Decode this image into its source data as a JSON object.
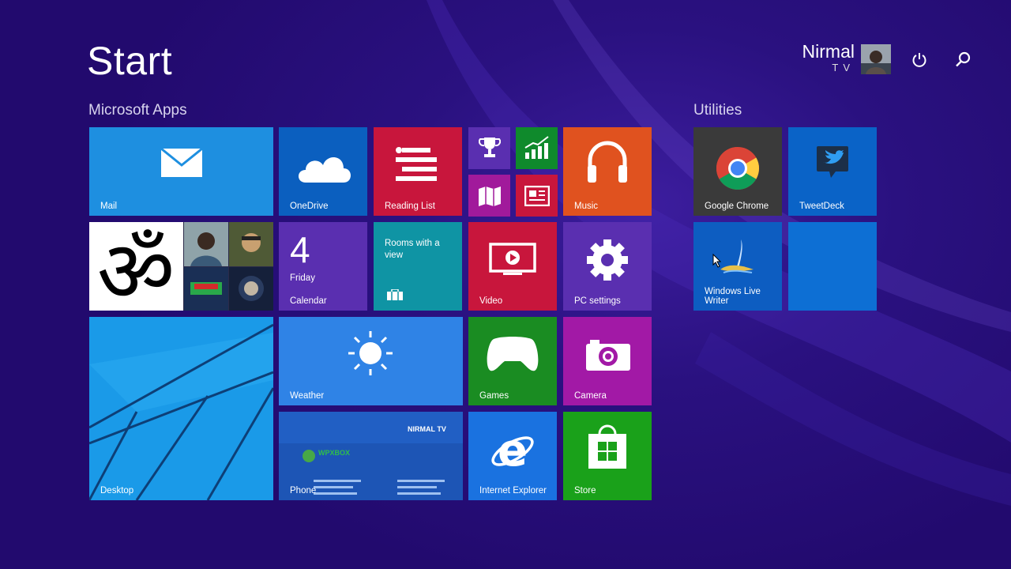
{
  "page_title": "Start",
  "user": {
    "first_name": "Nirmal",
    "last_name": "TV"
  },
  "groups": {
    "apps": "Microsoft Apps",
    "utilities": "Utilities"
  },
  "tiles": {
    "mail": "Mail",
    "onedrive": "OneDrive",
    "reading_list": "Reading List",
    "music": "Music",
    "calendar": {
      "day": "4",
      "weekday": "Friday",
      "label": "Calendar"
    },
    "travel": {
      "text": "Rooms with a view"
    },
    "video": "Video",
    "pc_settings": "PC settings",
    "desktop": "Desktop",
    "weather": "Weather",
    "games": "Games",
    "camera": "Camera",
    "phone": {
      "label": "Phone",
      "card_name": "NIRMAL TV",
      "card_logo": "WPXBOX"
    },
    "ie": "Internet Explorer",
    "store": "Store",
    "chrome": "Google Chrome",
    "tweetdeck": "TweetDeck",
    "live_writer": "Windows Live Writer"
  },
  "colors": {
    "background": "#220a6e",
    "mail": "#1e8fe0",
    "onedrive": "#0b5fbf",
    "reading_list": "#c8163c",
    "music": "#e0521f",
    "purple_tile": "#5a2fb0",
    "green_tile": "#0f8a2c",
    "magenta_tile": "#a11a9b",
    "travel": "#0f94a4",
    "video": "#c8163c",
    "pc_settings": "#5a2fb0",
    "weather": "#2f83e6",
    "games": "#1a8c22",
    "camera": "#a219a6",
    "ie": "#1a72e0",
    "store": "#1aa11a",
    "chrome": "#3a3a3a",
    "tweetdeck": "#0a63c7",
    "live_writer": "#0d5dc1",
    "empty_tile": "#0d6fd4"
  }
}
